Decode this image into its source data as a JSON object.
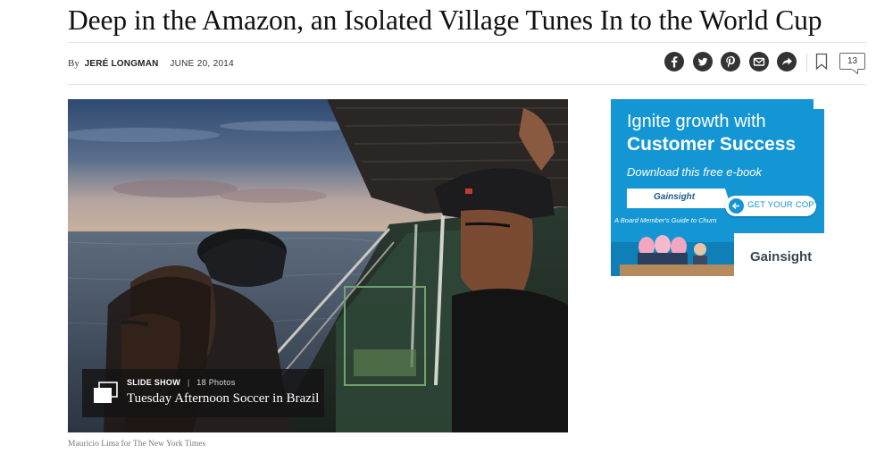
{
  "article": {
    "headline": "Deep in the Amazon, an Isolated Village Tunes In to the World Cup",
    "byline_prefix": "By",
    "author": "JERÉ LONGMAN",
    "date": "JUNE 20, 2014",
    "comment_count": "13"
  },
  "share_tools": [
    {
      "name": "facebook-icon"
    },
    {
      "name": "twitter-icon"
    },
    {
      "name": "pinterest-icon"
    },
    {
      "name": "email-icon"
    },
    {
      "name": "share-icon"
    },
    {
      "name": "bookmark-icon"
    }
  ],
  "media": {
    "slideshow_kicker": "SLIDE SHOW",
    "slideshow_separator": "|",
    "slideshow_count": "18 Photos",
    "slideshow_title": "Tuesday Afternoon Soccer in Brazil",
    "credit": "Mauricio Lima for The New York Times"
  },
  "ad": {
    "line1": "Ignite growth with",
    "line2": "Customer Success",
    "subline": "Download this free e-book",
    "brand_top": "Gainsight",
    "cta": "GET YOUR COPY",
    "guide_caption": "A Board Member's Guide to Churn",
    "brand_bottom": "Gainsight",
    "background_color": "#1596d4"
  },
  "colors": {
    "icon_fill": "#333333",
    "rule": "#e2e2e2"
  }
}
